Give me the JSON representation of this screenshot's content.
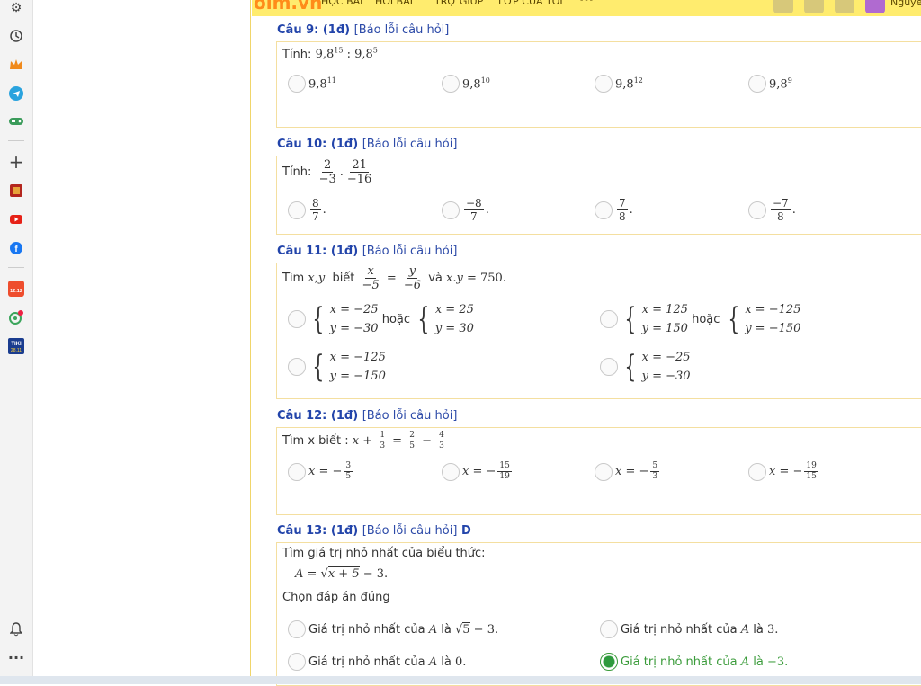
{
  "topbar": {
    "logo": "olm.vn",
    "nav": [
      "HỌC BÀI",
      "HỎI BÀI",
      "TRỢ GIÚP",
      "LỚP CỦA TÔI",
      "···"
    ],
    "user": "Nguyễ"
  },
  "rail": {
    "icons": [
      "gear-icon",
      "history-icon",
      "crown-icon",
      "telegram-icon",
      "gamepad-icon",
      "plus-icon",
      "book-app-icon",
      "youtube-icon",
      "facebook-icon",
      "shopee-sale-icon",
      "chrome-dev-icon",
      "tiki-icon",
      "bell-icon",
      "more-icon"
    ],
    "badges": {
      "shopee": "12.12",
      "tiki": "TIKI 28.11"
    }
  },
  "report_label": "[Báo lỗi câu hỏi]",
  "q9": {
    "header": "Câu 9: (1đ)",
    "prompt": "Tính:",
    "options": [
      "9,8",
      "9,8",
      "9,8",
      "9,8"
    ],
    "expos": [
      "11",
      "10",
      "12",
      "9"
    ]
  },
  "q10": {
    "header": "Câu 10: (1đ)",
    "prompt": "Tính:",
    "options": [
      [
        "8",
        "7"
      ],
      [
        "−8",
        "7"
      ],
      [
        "7",
        "8"
      ],
      [
        "−7",
        "8"
      ]
    ]
  },
  "q11": {
    "header": "Câu 11: (1đ)",
    "prompt_a": "Tìm",
    "prompt_b": "biết",
    "prompt_c": "và",
    "or_word": "hoặc"
  },
  "q12": {
    "header": "Câu 12: (1đ)",
    "prompt": "Tìm x biết :",
    "options": [
      [
        "3",
        "5"
      ],
      [
        "15",
        "19"
      ],
      [
        "5",
        "3"
      ],
      [
        "19",
        "15"
      ]
    ]
  },
  "q13": {
    "header": "Câu 13: (1đ)",
    "answer_mark": "D",
    "prompt": "Tìm giá trị nhỏ nhất của biểu thức:",
    "choose": "Chọn đáp án đúng",
    "option_text": "Giá trị nhỏ nhất của",
    "la": "là",
    "selected_index": 3
  }
}
